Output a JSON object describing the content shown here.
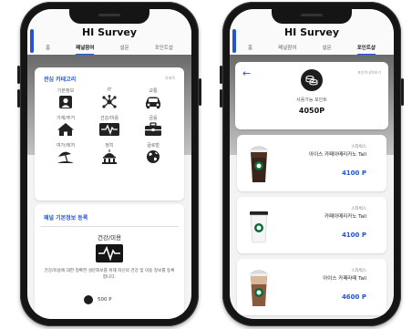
{
  "left_phone": {
    "app_title": "HI Survey",
    "tabs": [
      {
        "label": "홈",
        "active": false
      },
      {
        "label": "패널참여",
        "active": true
      },
      {
        "label": "설문",
        "active": false
      },
      {
        "label": "포인트샵",
        "active": false
      }
    ],
    "categories": {
      "title": "관심 카테고리",
      "edit_link": "자세히",
      "items": [
        {
          "label": "기본정보",
          "icon": "person-id-icon"
        },
        {
          "label": "IT",
          "icon": "network-icon"
        },
        {
          "label": "교통",
          "icon": "car-icon"
        },
        {
          "label": "가계/주거",
          "icon": "house-icon"
        },
        {
          "label": "건강/미용",
          "icon": "heartbeat-icon"
        },
        {
          "label": "금융",
          "icon": "briefcase-icon"
        },
        {
          "label": "여가/레저",
          "icon": "beach-umbrella-icon"
        },
        {
          "label": "정치",
          "icon": "government-building-icon"
        },
        {
          "label": "글로벌",
          "icon": "globe-icon"
        }
      ]
    },
    "panel_register": {
      "title": "패널 기본정보 등록",
      "category": "건강/미용",
      "description": "건강/미용에 대한 정확한 설문화보를 위해 자신의 건강 및 미용 정보를 등록합니다.",
      "points": "500 P"
    }
  },
  "right_phone": {
    "app_title": "HI Survey",
    "tabs": [
      {
        "label": "홈",
        "active": false
      },
      {
        "label": "패널참여",
        "active": false
      },
      {
        "label": "설문",
        "active": false
      },
      {
        "label": "포인트샵",
        "active": true
      }
    ],
    "points_card": {
      "history_link": "포인트내역보기",
      "label": "사용가능 포인트",
      "value": "4050P"
    },
    "products": [
      {
        "brand": "스타벅스",
        "name": "아이스 카페아메리카노 Tall",
        "price": "4100 P",
        "type": "iced-americano"
      },
      {
        "brand": "스타벅스",
        "name": "카페아메리카노 Tall",
        "price": "4100 P",
        "type": "hot-americano"
      },
      {
        "brand": "스타벅스",
        "name": "아이스 카페라떼 Tall",
        "price": "4600 P",
        "type": "iced-latte"
      }
    ]
  },
  "colors": {
    "accent": "#2452d8",
    "frame": "#151515"
  }
}
